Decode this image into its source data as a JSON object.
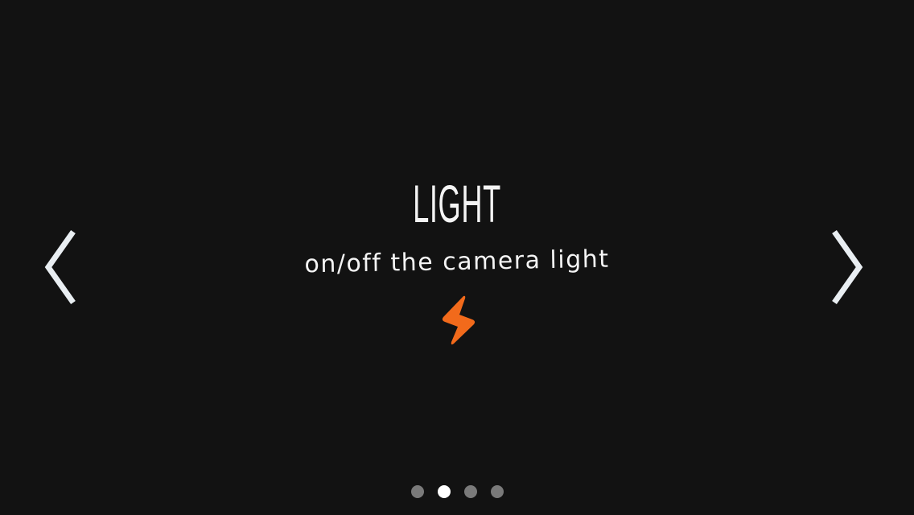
{
  "screen": {
    "title": "LIGHT",
    "subtitle": "on/off the camera light"
  },
  "icons": {
    "previous": "chevron-left-icon",
    "next": "chevron-right-icon",
    "feature": "lightning-bolt-icon"
  },
  "pager": {
    "total": 4,
    "active_index": 1
  },
  "colors": {
    "background": "#121212",
    "text": "#f4f4f4",
    "accent": "#f26a1b",
    "arrow": "#e9eef2",
    "dot_inactive": "#7a7a7a",
    "dot_active": "#ffffff"
  }
}
